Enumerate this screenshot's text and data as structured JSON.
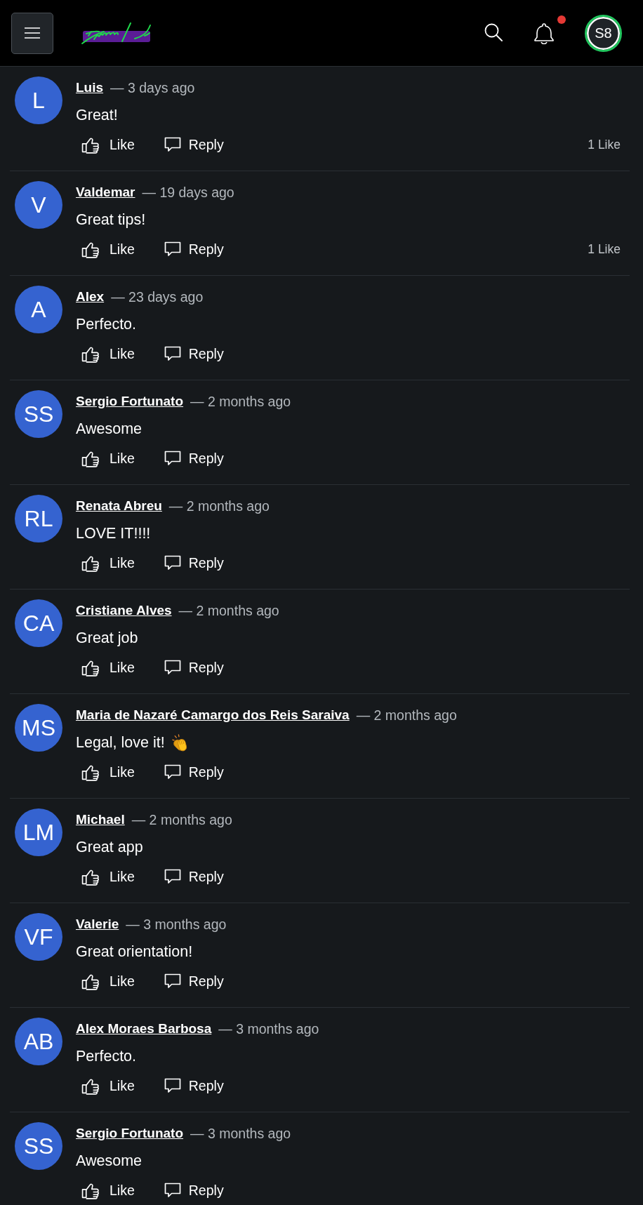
{
  "header": {
    "avatar": "S8",
    "online": true,
    "unread_notifications": true
  },
  "comments": [
    {
      "initials": "L",
      "author": "Luis",
      "time": "— 3 days ago",
      "text": "Great!",
      "emoji": false,
      "like_label": "Like",
      "reply_label": "Reply",
      "likes": "1 Like"
    },
    {
      "initials": "V",
      "author": "Valdemar",
      "time": "— 19 days ago",
      "text": "Great tips!",
      "emoji": false,
      "like_label": "Like",
      "reply_label": "Reply",
      "likes": "1 Like"
    },
    {
      "initials": "A",
      "author": "Alex",
      "time": "— 23 days ago",
      "text": "Perfecto.",
      "emoji": false,
      "like_label": "Like",
      "reply_label": "Reply"
    },
    {
      "initials": "SS",
      "author": "Sergio Fortunato",
      "time": "— 2 months ago",
      "text": "Awesome",
      "emoji": false,
      "like_label": "Like",
      "reply_label": "Reply"
    },
    {
      "initials": "RL",
      "author": "Renata Abreu",
      "time": "— 2 months ago",
      "text": "LOVE IT!!!!",
      "emoji": false,
      "like_label": "Like",
      "reply_label": "Reply"
    },
    {
      "initials": "CA",
      "author": "Cristiane Alves",
      "time": "— 2 months ago",
      "text": "Great job",
      "emoji": false,
      "like_label": "Like",
      "reply_label": "Reply"
    },
    {
      "initials": "MS",
      "author": "Maria de Nazaré Camargo dos Reis Saraiva",
      "time": "— 2 months ago",
      "text": "Legal, love it!",
      "emoji": true,
      "like_label": "Like",
      "reply_label": "Reply"
    },
    {
      "initials": "LM",
      "author": "Michael",
      "time": "— 2 months ago",
      "text": "Great app",
      "emoji": false,
      "like_label": "Like",
      "reply_label": "Reply"
    },
    {
      "initials": "VF",
      "author": "Valerie",
      "time": "— 3 months ago",
      "text": "Great orientation!",
      "emoji": false,
      "like_label": "Like",
      "reply_label": "Reply"
    },
    {
      "initials": "AB",
      "author": "Alex Moraes Barbosa",
      "time": "— 3 months ago",
      "text": "Perfecto.",
      "emoji": false,
      "like_label": "Like",
      "reply_label": "Reply"
    },
    {
      "initials": "SS",
      "author": "Sergio Fortunato",
      "time": "— 3 months ago",
      "text": "Awesome",
      "emoji": false,
      "like_label": "Like",
      "reply_label": "Reply"
    }
  ]
}
